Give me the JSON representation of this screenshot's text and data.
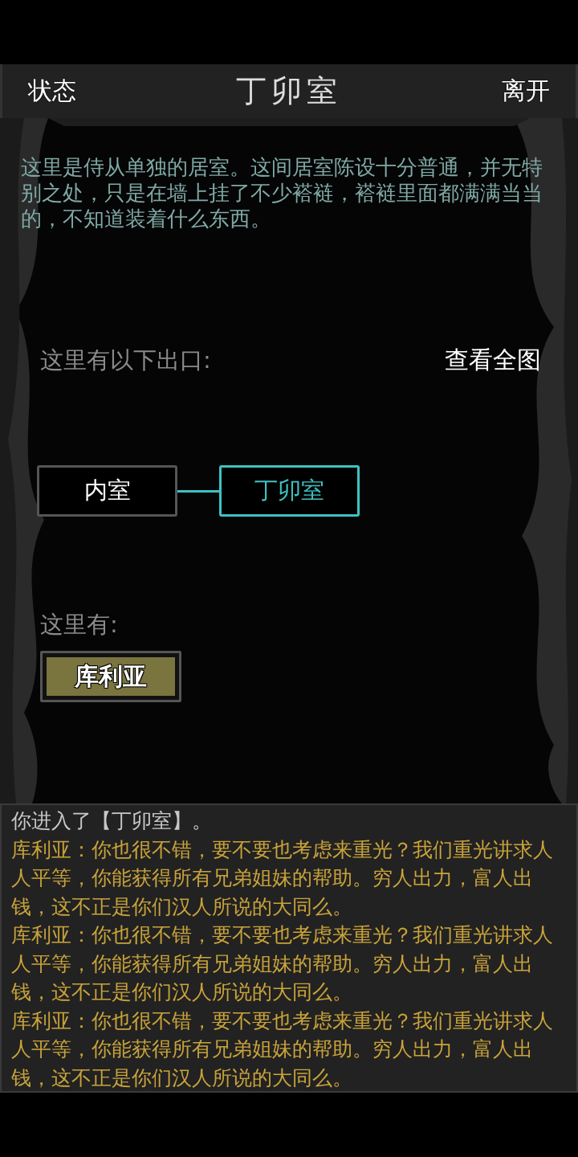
{
  "header": {
    "left_button": "状态",
    "title": "丁卯室",
    "right_button": "离开"
  },
  "description": "这里是侍从单独的居室。这间居室陈设十分普通，并无特别之处，只是在墙上挂了不少褡裢，褡裢里面都满满当当的，不知道装着什么东西。",
  "exits": {
    "label": "这里有以下出口:",
    "map_button": "查看全图",
    "rooms": [
      {
        "name": "内室",
        "selected": false
      },
      {
        "name": "丁卯室",
        "selected": true
      }
    ]
  },
  "present": {
    "label": "这里有:",
    "npcs": [
      "库利亚"
    ]
  },
  "log": [
    {
      "kind": "system",
      "text": "你进入了【丁卯室】。"
    },
    {
      "kind": "speech",
      "text": "库利亚：你也很不错，要不要也考虑来重光？我们重光讲求人人平等，你能获得所有兄弟姐妹的帮助。穷人出力，富人出钱，这不正是你们汉人所说的大同么。"
    },
    {
      "kind": "speech",
      "text": "库利亚：你也很不错，要不要也考虑来重光？我们重光讲求人人平等，你能获得所有兄弟姐妹的帮助。穷人出力，富人出钱，这不正是你们汉人所说的大同么。"
    },
    {
      "kind": "speech",
      "text": "库利亚：你也很不错，要不要也考虑来重光？我们重光讲求人人平等，你能获得所有兄弟姐妹的帮助。穷人出力，富人出钱，这不正是你们汉人所说的大同么。"
    }
  ]
}
